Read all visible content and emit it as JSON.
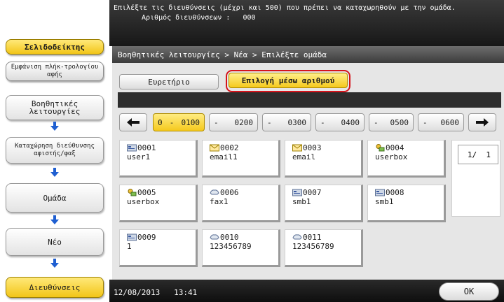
{
  "header": {
    "instruction": "Επιλέξτε τις διευθύνσεις (μέχρι και 500) που πρέπει να καταχωρηθούν με την ομάδα.",
    "count_label": "Αριθμός διευθύνσεων :",
    "count_value": "000"
  },
  "sidebar": {
    "bookmark": "Σελιδοδείκτης",
    "display_keys": "Εμφάνιση πλήκ-τρολογίου αφής",
    "steps": [
      {
        "label": "Βοηθητικές λειτουργίες"
      },
      {
        "label": "Καταχώρηση διεύθυνσης αφιστής/φαξ"
      },
      {
        "label": "Ομάδα"
      },
      {
        "label": "Νέο"
      },
      {
        "label": "Διευθύνσεις"
      }
    ]
  },
  "breadcrumb": "Βοηθητικές λειτουργίες > Νέα > Επιλέξτε ομάδα",
  "tabs": {
    "index": "Ευρετήριο",
    "by_number": "Επιλογή μέσω αριθμού"
  },
  "ranges": [
    {
      "from": "0",
      "to": "0100",
      "active": true
    },
    {
      "from": "-",
      "to": "0200",
      "active": false
    },
    {
      "from": "-",
      "to": "0300",
      "active": false
    },
    {
      "from": "-",
      "to": "0400",
      "active": false
    },
    {
      "from": "-",
      "to": "0500",
      "active": false
    },
    {
      "from": "-",
      "to": "0600",
      "active": false
    }
  ],
  "range_sep": "-",
  "entries": [
    {
      "num": "0001",
      "name": "user1",
      "icon": "smb-icon"
    },
    {
      "num": "0002",
      "name": "email1",
      "icon": "email-icon"
    },
    {
      "num": "0003",
      "name": "email",
      "icon": "email-icon"
    },
    {
      "num": "0004",
      "name": "userbox",
      "icon": "box-icon"
    },
    {
      "num": "0005",
      "name": "userbox",
      "icon": "box-icon"
    },
    {
      "num": "0006",
      "name": "fax1",
      "icon": "fax-icon"
    },
    {
      "num": "0007",
      "name": "smb1",
      "icon": "smb-icon"
    },
    {
      "num": "0008",
      "name": "smb1",
      "icon": "smb-icon"
    },
    {
      "num": "0009",
      "name": "1",
      "icon": "smb-icon"
    },
    {
      "num": "0010",
      "name": "123456789",
      "icon": "fax-icon"
    },
    {
      "num": "0011",
      "name": "123456789",
      "icon": "fax-icon"
    }
  ],
  "page": {
    "current": "1/",
    "total": "1"
  },
  "footer": {
    "date": "12/08/2013",
    "time": "13:41",
    "ok": "OK"
  },
  "colors": {
    "accent_yellow": "#f5c91d",
    "highlight_red": "#d5141c"
  }
}
